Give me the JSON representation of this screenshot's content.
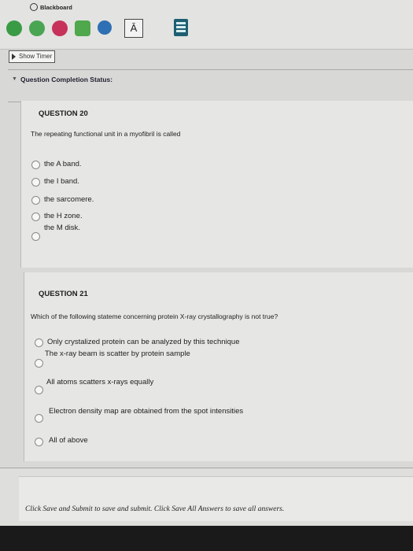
{
  "app": {
    "title": "Blackboard"
  },
  "toolbar": {
    "text_button_label": "Ā"
  },
  "timer": {
    "label": "Show Timer"
  },
  "completion": {
    "label": "Question Completion Status:"
  },
  "questions": [
    {
      "title": "QUESTION 20",
      "prompt": "The repeating functional unit in a myofibril is called",
      "options": [
        "the A band.",
        "the I band.",
        "the sarcomere.",
        "the H zone.",
        "the M disk."
      ]
    },
    {
      "title": "QUESTION 21",
      "prompt": "Which of the following stateme concerning protein X-ray crystallography is not true?",
      "options": [
        "Only crystalized protein can be analyzed by this technique",
        "The x-ray beam is scatter by protein sample",
        "All atoms scatters x-rays equally",
        "Electron density map are obtained from the spot intensities",
        "All of above"
      ]
    }
  ],
  "footer": {
    "instruction": "Click Save and Submit to save and submit. Click Save All Answers to save all answers."
  },
  "colors": {
    "background": "#d8d8d6",
    "calculator": "#1d5e72",
    "bottom_bar": "#1a1a1a"
  }
}
